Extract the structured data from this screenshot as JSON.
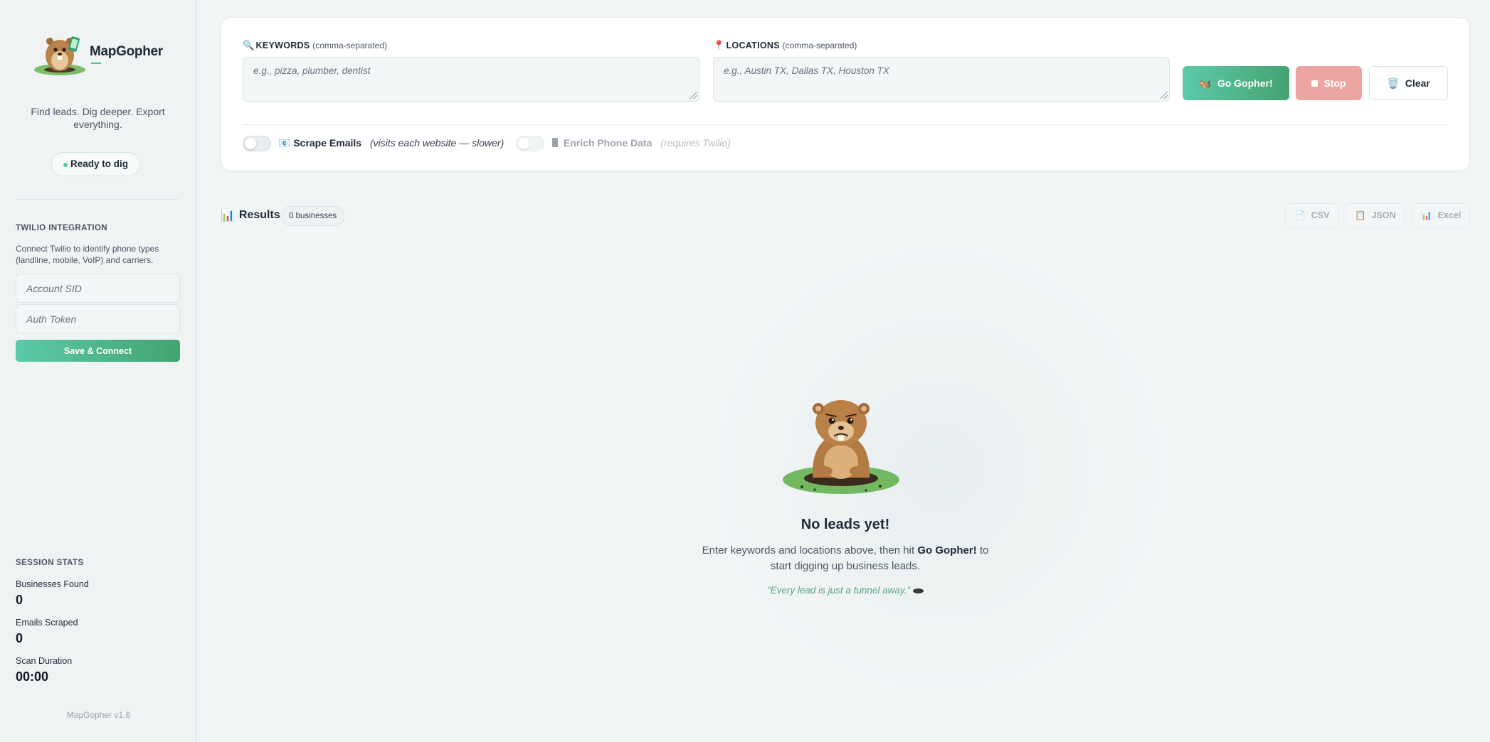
{
  "app": {
    "name": "MapGopher",
    "tagline": "Find leads. Dig deeper. Export everything.",
    "version": "MapGopher v1.6"
  },
  "status": {
    "label": "Ready to dig"
  },
  "twilio": {
    "title": "TWILIO INTEGRATION",
    "description": "Connect Twilio to identify phone types (landline, mobile, VoIP) and carriers.",
    "account_sid_placeholder": "Account SID",
    "auth_token_placeholder": "Auth Token",
    "save_label": "Save & Connect"
  },
  "stats": {
    "title": "SESSION STATS",
    "items": [
      {
        "label": "Businesses Found",
        "value": "0"
      },
      {
        "label": "Emails Scraped",
        "value": "0"
      },
      {
        "label": "Scan Duration",
        "value": "00:00"
      }
    ]
  },
  "search": {
    "keywords_label": "KEYWORDS",
    "keywords_sub": "(comma-separated)",
    "keywords_placeholder": "e.g., pizza, plumber, dentist",
    "locations_label": "LOCATIONS",
    "locations_sub": "(comma-separated)",
    "locations_placeholder": "e.g., Austin TX, Dallas TX, Houston TX",
    "go_label": "Go Gopher!",
    "stop_label": "Stop",
    "clear_label": "Clear",
    "scrape_emails_label": "Scrape Emails",
    "scrape_emails_note": "(visits each website — slower)",
    "enrich_phone_label": "Enrich Phone Data",
    "enrich_phone_note": "(requires Twilio)"
  },
  "results": {
    "title": "Results",
    "count": "0 businesses",
    "exports": [
      "CSV",
      "JSON",
      "Excel"
    ]
  },
  "empty": {
    "title": "No leads yet!",
    "desc_before": "Enter keywords and locations above, then hit",
    "desc_bold": "Go Gopher!",
    "desc_after": "to start digging up business leads.",
    "quote": "\"Every lead is just a tunnel away.\""
  },
  "colors": {
    "accent": "#4fb88c",
    "stop": "#eba6a2",
    "quote": "#5aa582"
  }
}
